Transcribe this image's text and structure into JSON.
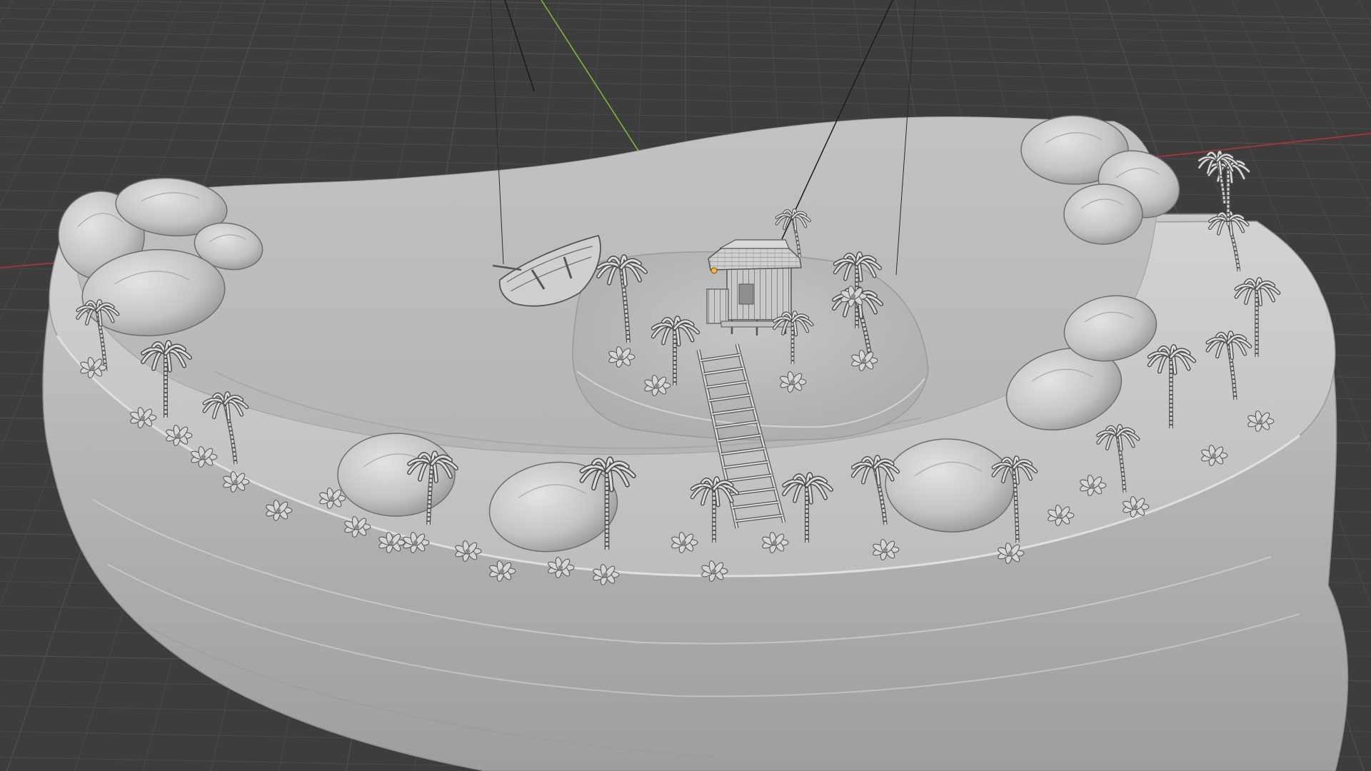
{
  "viewport": {
    "name": "3D Viewport",
    "shading_mode": "solid",
    "background_color": "#3d3d3d",
    "grid_color": "#4a4a4a",
    "grid_major_color": "#525252",
    "x_axis_color": "#b8313f",
    "y_axis_color": "#7fb43a",
    "model_base_color": "#b9b9b9",
    "model_light_color": "#d7d7d7",
    "model_shadow_color": "#8a8a8a"
  },
  "scene": {
    "objects": [
      "island-base",
      "sand-plateau",
      "central-mound",
      "hut",
      "ladder",
      "rowboat",
      "boulders",
      "palm-trees",
      "plants",
      "lamp-cables",
      "point-light"
    ],
    "palm_tree_count": 22,
    "boulder_count": 12,
    "light_color": "#ffb347"
  }
}
